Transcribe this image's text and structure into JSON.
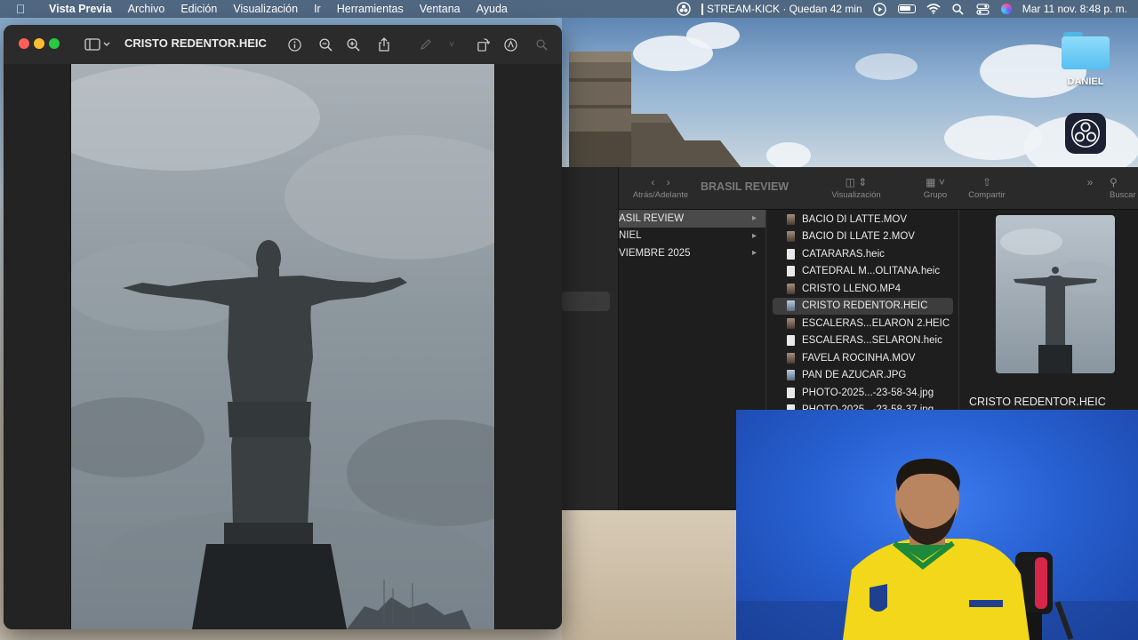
{
  "menubar": {
    "app": "Vista Previa",
    "items": [
      "Archivo",
      "Edición",
      "Visualización",
      "Ir",
      "Herramientas",
      "Ventana",
      "Ayuda"
    ],
    "stream_status": "STREAM-KICK · Quedan 42 min",
    "datetime": "Mar 11 nov.  8:48 p. m."
  },
  "desktop": {
    "folder_label": "DANIEL"
  },
  "preview": {
    "title": "CRISTO REDENTOR.HEIC"
  },
  "finder": {
    "title": "BRASIL REVIEW",
    "toolbar": {
      "back_forward": "Atrás/Adelante",
      "view": "Visualización",
      "group": "Grupo",
      "share": "Compartir",
      "search": "Buscar"
    },
    "column1": [
      {
        "label": "ASIL REVIEW",
        "selected": true
      },
      {
        "label": "NIEL",
        "selected": false
      },
      {
        "label": "VIEMBRE 2025",
        "selected": false
      }
    ],
    "files": [
      {
        "name": "BACIO DI LATTE.MOV",
        "kind": "vid"
      },
      {
        "name": "BACIO DI LLATE 2.MOV",
        "kind": "vid"
      },
      {
        "name": "CATARARAS.heic",
        "kind": "doc"
      },
      {
        "name": "CATEDRAL M...OLITANA.heic",
        "kind": "doc"
      },
      {
        "name": "CRISTO LLENO.MP4",
        "kind": "vid"
      },
      {
        "name": "CRISTO REDENTOR.HEIC",
        "kind": "img",
        "selected": true
      },
      {
        "name": "ESCALERAS...ELARON 2.HEIC",
        "kind": "vid"
      },
      {
        "name": "ESCALERAS...SELARON.heic",
        "kind": "doc"
      },
      {
        "name": "FAVELA ROCINHA.MOV",
        "kind": "vid"
      },
      {
        "name": "PAN DE AZUCAR.JPG",
        "kind": "img"
      },
      {
        "name": "PHOTO-2025...-23-58-34.jpg",
        "kind": "doc"
      },
      {
        "name": "PHOTO-2025...-23-58-37.jpg",
        "kind": "doc"
      }
    ],
    "preview_name": "CRISTO REDENTOR.HEIC"
  }
}
